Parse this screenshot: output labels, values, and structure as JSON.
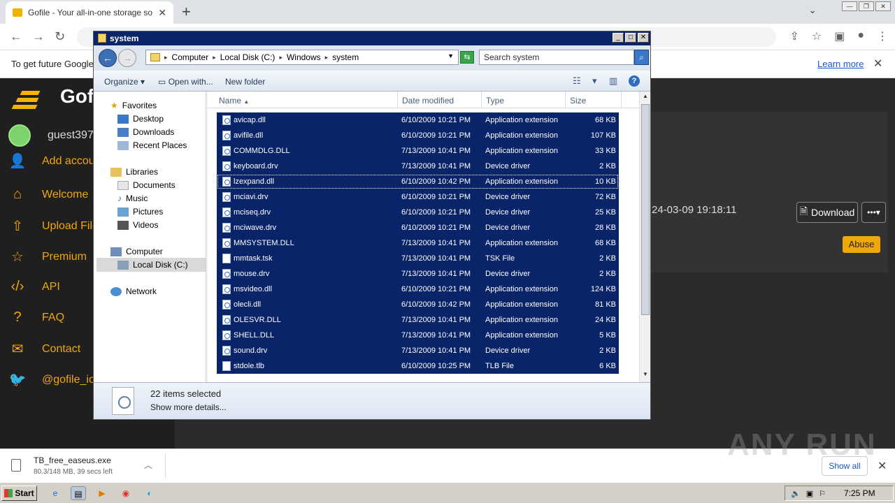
{
  "browser": {
    "tab_title": "Gofile - Your all-in-one storage soluti",
    "new_tab": "+",
    "infobar_message": "To get future Google",
    "learn_more": "Learn more"
  },
  "gofile": {
    "brand": "Gofi",
    "username": "guest397",
    "nav": [
      {
        "label": "Add accou",
        "icon": "add-user-icon"
      },
      {
        "label": "Welcome",
        "icon": "home-icon"
      },
      {
        "label": "Upload File",
        "icon": "upload-icon"
      },
      {
        "label": "Premium",
        "icon": "star-icon"
      },
      {
        "label": "API",
        "icon": "code-icon"
      },
      {
        "label": "FAQ",
        "icon": "question-icon"
      },
      {
        "label": "Contact",
        "icon": "mail-icon"
      },
      {
        "label": "@gofile_io",
        "icon": "twitter-icon"
      }
    ],
    "file_date": "24-03-09 19:18:11",
    "download_label": "Download",
    "abuse_label": "Abuse"
  },
  "explorer": {
    "title": "system",
    "address": [
      "Computer",
      "Local Disk (C:)",
      "Windows",
      "system"
    ],
    "search_placeholder": "Search system",
    "commands": {
      "organize": "Organize",
      "open_with": "Open with...",
      "new_folder": "New folder"
    },
    "nav_pane": {
      "favorites": "Favorites",
      "desktop": "Desktop",
      "downloads": "Downloads",
      "recent": "Recent Places",
      "libraries": "Libraries",
      "documents": "Documents",
      "music": "Music",
      "pictures": "Pictures",
      "videos": "Videos",
      "computer": "Computer",
      "local_disk": "Local Disk (C:)",
      "network": "Network"
    },
    "columns": {
      "name": "Name",
      "date": "Date modified",
      "type": "Type",
      "size": "Size"
    },
    "files": [
      {
        "name": "avicap.dll",
        "date": "6/10/2009 10:21 PM",
        "type": "Application extension",
        "size": "68 KB"
      },
      {
        "name": "avifile.dll",
        "date": "6/10/2009 10:21 PM",
        "type": "Application extension",
        "size": "107 KB"
      },
      {
        "name": "COMMDLG.DLL",
        "date": "7/13/2009 10:41 PM",
        "type": "Application extension",
        "size": "33 KB"
      },
      {
        "name": "keyboard.drv",
        "date": "7/13/2009 10:41 PM",
        "type": "Device driver",
        "size": "2 KB"
      },
      {
        "name": "lzexpand.dll",
        "date": "6/10/2009 10:42 PM",
        "type": "Application extension",
        "size": "10 KB"
      },
      {
        "name": "mciavi.drv",
        "date": "6/10/2009 10:21 PM",
        "type": "Device driver",
        "size": "72 KB"
      },
      {
        "name": "mciseq.drv",
        "date": "6/10/2009 10:21 PM",
        "type": "Device driver",
        "size": "25 KB"
      },
      {
        "name": "mciwave.drv",
        "date": "6/10/2009 10:21 PM",
        "type": "Device driver",
        "size": "28 KB"
      },
      {
        "name": "MMSYSTEM.DLL",
        "date": "7/13/2009 10:41 PM",
        "type": "Application extension",
        "size": "68 KB"
      },
      {
        "name": "mmtask.tsk",
        "date": "7/13/2009 10:41 PM",
        "type": "TSK File",
        "size": "2 KB"
      },
      {
        "name": "mouse.drv",
        "date": "7/13/2009 10:41 PM",
        "type": "Device driver",
        "size": "2 KB"
      },
      {
        "name": "msvideo.dll",
        "date": "6/10/2009 10:21 PM",
        "type": "Application extension",
        "size": "124 KB"
      },
      {
        "name": "olecli.dll",
        "date": "6/10/2009 10:42 PM",
        "type": "Application extension",
        "size": "81 KB"
      },
      {
        "name": "OLESVR.DLL",
        "date": "7/13/2009 10:41 PM",
        "type": "Application extension",
        "size": "24 KB"
      },
      {
        "name": "SHELL.DLL",
        "date": "7/13/2009 10:41 PM",
        "type": "Application extension",
        "size": "5 KB"
      },
      {
        "name": "sound.drv",
        "date": "7/13/2009 10:41 PM",
        "type": "Device driver",
        "size": "2 KB"
      },
      {
        "name": "stdole.tlb",
        "date": "6/10/2009 10:25 PM",
        "type": "TLB File",
        "size": "6 KB"
      }
    ],
    "selection_count": "22 items selected",
    "show_more": "Show more details..."
  },
  "download_bar": {
    "filename": "TB_free_easeus.exe",
    "status": "80.3/148 MB, 39 secs left",
    "show_all": "Show all"
  },
  "taskbar": {
    "start": "Start",
    "time": "7:25 PM"
  },
  "watermark": "ANY RUN"
}
